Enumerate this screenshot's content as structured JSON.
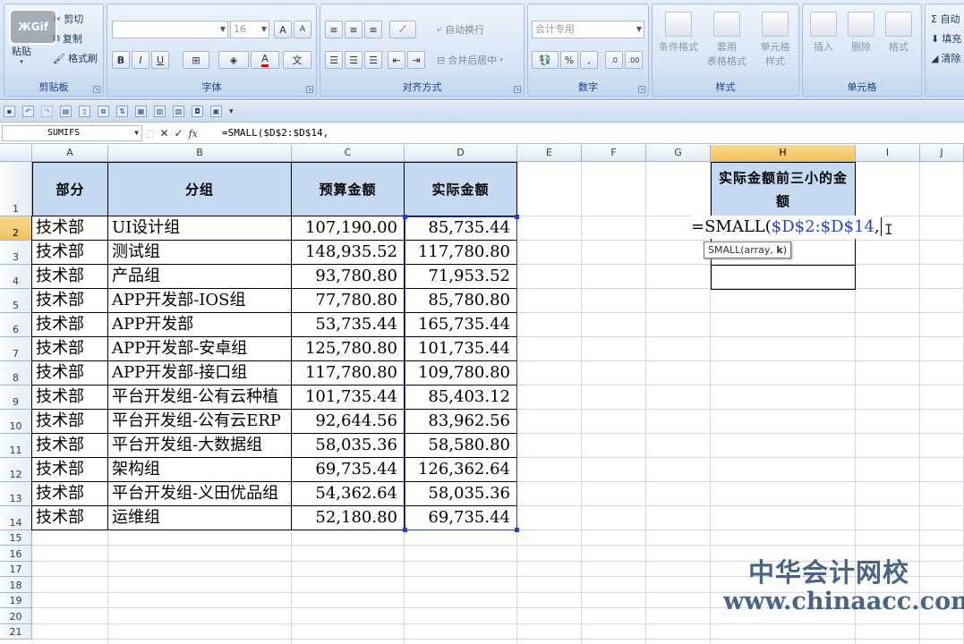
{
  "ribbon": {
    "clipboard": {
      "paste": "粘贴",
      "cut": "剪切",
      "copy": "复制",
      "format_painter": "格式刷",
      "group": "剪贴板"
    },
    "font": {
      "font_name": "",
      "font_size": "16",
      "bold": "B",
      "italic": "I",
      "underline": "U",
      "group": "字体"
    },
    "align": {
      "wrap": "自动换行",
      "merge": "合并后居中",
      "group": "对齐方式"
    },
    "number": {
      "format": "会计专用",
      "percent": "%",
      "comma": ",",
      "group": "数字"
    },
    "styles": {
      "conditional": "条件格式",
      "table": "套用\n表格格式",
      "cell_styles": "单元格\n样式",
      "group": "样式"
    },
    "cells": {
      "insert": "插入",
      "delete": "删除",
      "format": "格式",
      "group": "单元格"
    },
    "editing": {
      "sum": "Σ 自动",
      "fill": "填充",
      "clear": "清除"
    }
  },
  "gif_badge": "ЖGif",
  "formula_bar": {
    "name_box": "SUMIFS",
    "fx": "fx",
    "formula": "=SMALL($D$2:$D$14,"
  },
  "columns": [
    "A",
    "B",
    "C",
    "D",
    "E",
    "F",
    "G",
    "H",
    "I",
    "J"
  ],
  "rows": [
    "1",
    "2",
    "3",
    "4",
    "5",
    "6",
    "7",
    "8",
    "9",
    "10",
    "11",
    "12",
    "13",
    "14",
    "15",
    "16",
    "17",
    "18",
    "19",
    "20",
    "21"
  ],
  "table": {
    "headers": [
      "部分",
      "分组",
      "预算金额",
      "实际金额"
    ],
    "data": [
      [
        "技术部",
        "UI设计组",
        "107,190.00",
        "85,735.44"
      ],
      [
        "技术部",
        "测试组",
        "148,935.52",
        "117,780.80"
      ],
      [
        "技术部",
        "产品组",
        "93,780.80",
        "71,953.52"
      ],
      [
        "技术部",
        "APP开发部-IOS组",
        "77,780.80",
        "85,780.80"
      ],
      [
        "技术部",
        "APP开发部",
        "53,735.44",
        "165,735.44"
      ],
      [
        "技术部",
        "APP开发部-安卓组",
        "125,780.80",
        "101,735.44"
      ],
      [
        "技术部",
        "APP开发部-接口组",
        "117,780.80",
        "109,780.80"
      ],
      [
        "技术部",
        "平台开发组-公有云种植",
        "101,735.44",
        "85,403.12"
      ],
      [
        "技术部",
        "平台开发组-公有云ERP",
        "92,644.56",
        "83,962.56"
      ],
      [
        "技术部",
        "平台开发组-大数据组",
        "58,035.36",
        "58,580.80"
      ],
      [
        "技术部",
        "架构组",
        "69,735.44",
        "126,362.64"
      ],
      [
        "技术部",
        "平台开发组-义田优品组",
        "54,362.64",
        "58,035.36"
      ],
      [
        "技术部",
        "运维组",
        "52,180.80",
        "69,735.44"
      ]
    ]
  },
  "h_header": "实际金额前三小的金额",
  "edit": {
    "prefix": "=SMALL(",
    "ref": "$D$2:$D$14",
    "suffix": ","
  },
  "tooltip": {
    "fn": "SMALL(array, ",
    "arg": "k",
    ")": ")"
  },
  "watermark": {
    "cn": "中华会计网校",
    "url": "www.chinaacc.com"
  }
}
